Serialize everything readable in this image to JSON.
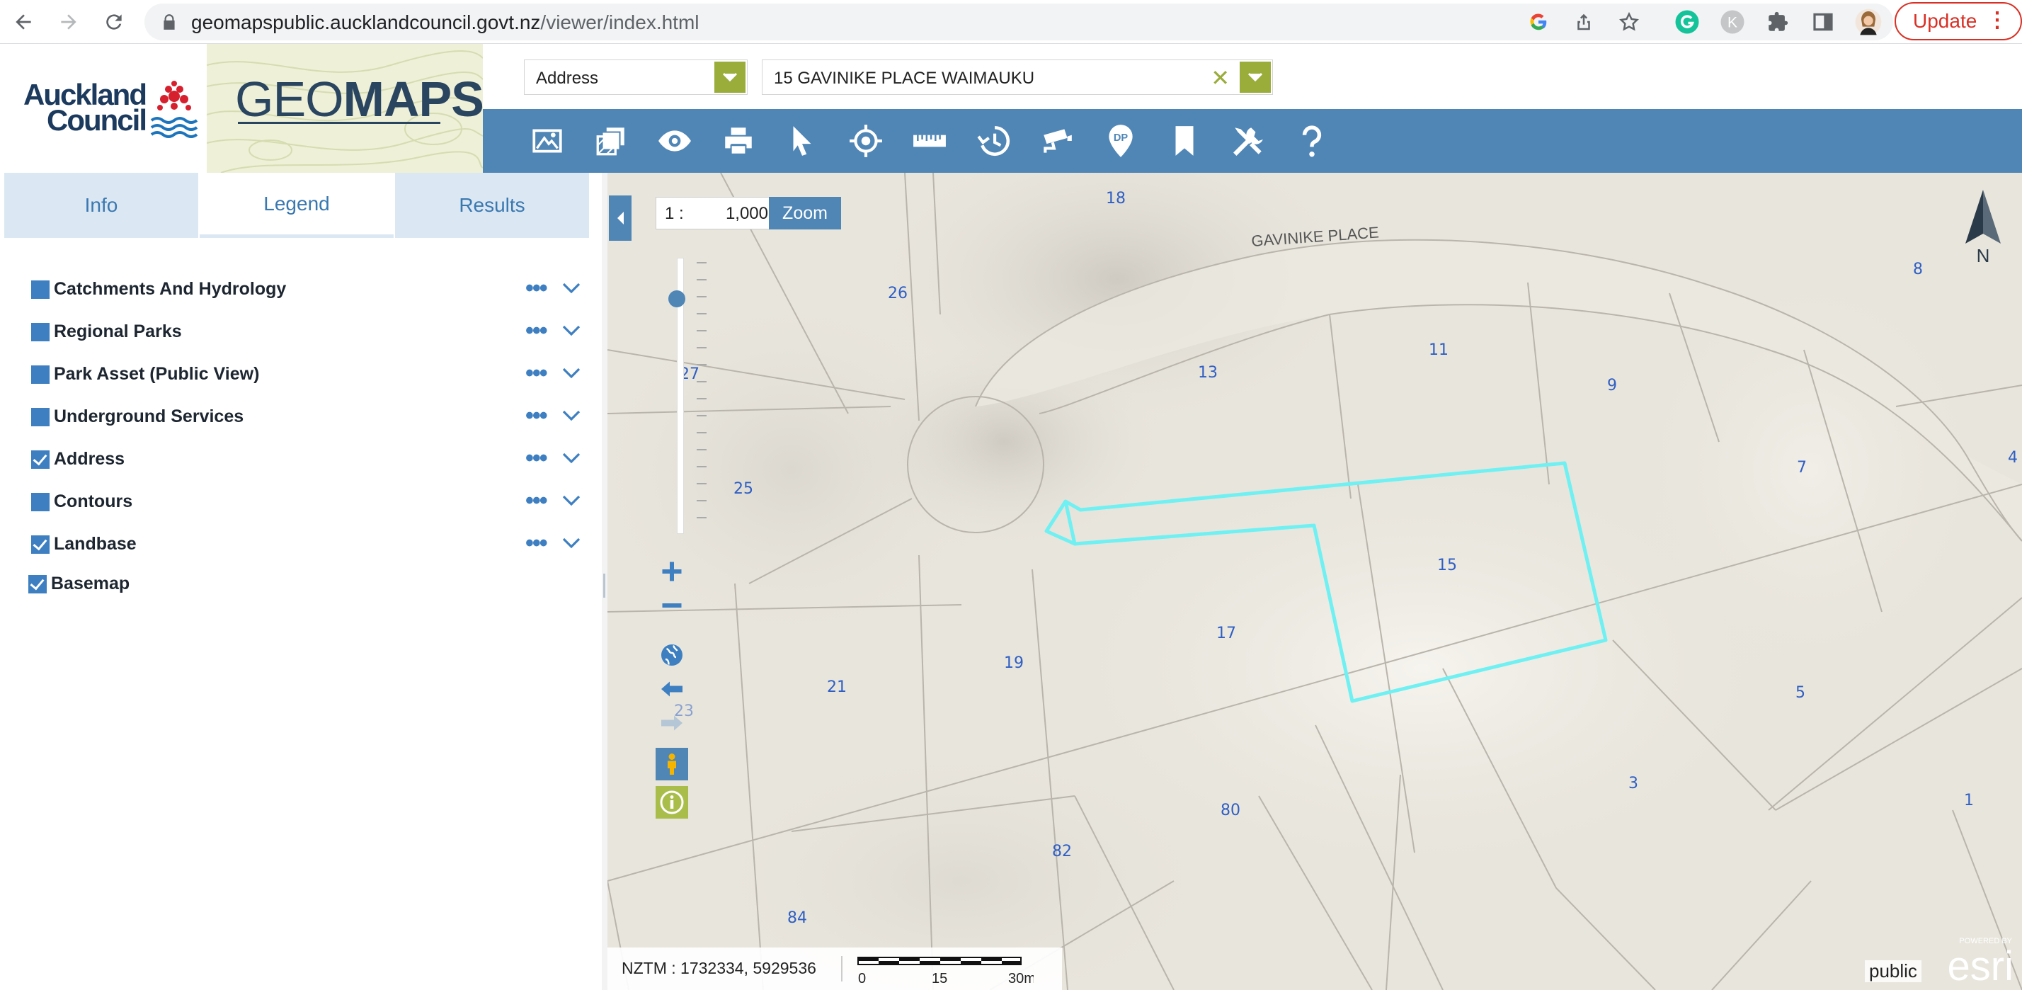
{
  "browser": {
    "url_host": "geomapspublic.aucklandcouncil.govt.nz",
    "url_path": "/viewer/index.html",
    "update_label": "Update",
    "extension_badge": "K"
  },
  "header": {
    "council_name_line1": "Auckland",
    "council_name_line2": "Council",
    "app_title_light": "GEO",
    "app_title_bold": "MAPS",
    "search_type": "Address",
    "search_value": "15 GAVINIKE PLACE WAIMAUKU"
  },
  "toolbar": {
    "icons": [
      "basemap-icon",
      "layers-icon",
      "visibility-icon",
      "print-icon",
      "select-icon",
      "locate-icon",
      "measure-icon",
      "history-icon",
      "camera-icon",
      "dp-marker-icon",
      "bookmark-icon",
      "tools-icon",
      "help-icon"
    ]
  },
  "panel": {
    "tabs": [
      "Info",
      "Legend",
      "Results"
    ],
    "active_tab": "Legend",
    "layers": [
      {
        "label": "Catchments And Hydrology",
        "checked": false
      },
      {
        "label": "Regional Parks",
        "checked": false
      },
      {
        "label": "Park Asset (Public View)",
        "checked": false
      },
      {
        "label": "Underground Services",
        "checked": false
      },
      {
        "label": "Address",
        "checked": true
      },
      {
        "label": "Contours",
        "checked": false
      },
      {
        "label": "Landbase",
        "checked": true
      }
    ],
    "basemap": {
      "label": "Basemap",
      "checked": true
    },
    "more_glyph": "•••"
  },
  "map": {
    "scale_prefix": "1 :",
    "scale_value": "1,000",
    "zoom_label": "Zoom",
    "north_label": "N",
    "street_label": "GAVINIKE PLACE",
    "lot_numbers": [
      "18",
      "26",
      "27",
      "13",
      "11",
      "9",
      "8",
      "25",
      "7",
      "4",
      "15",
      "17",
      "19",
      "21",
      "23",
      "5",
      "3",
      "80",
      "82",
      "1",
      "84"
    ],
    "coords": "NZTM : 1732334, 5929536",
    "scalebar_ticks": [
      "0",
      "15",
      "30m"
    ],
    "public_label": "public",
    "esri_powered": "POWERED BY",
    "esri_label": "esri",
    "highlight_color": "#6ff0f2"
  }
}
